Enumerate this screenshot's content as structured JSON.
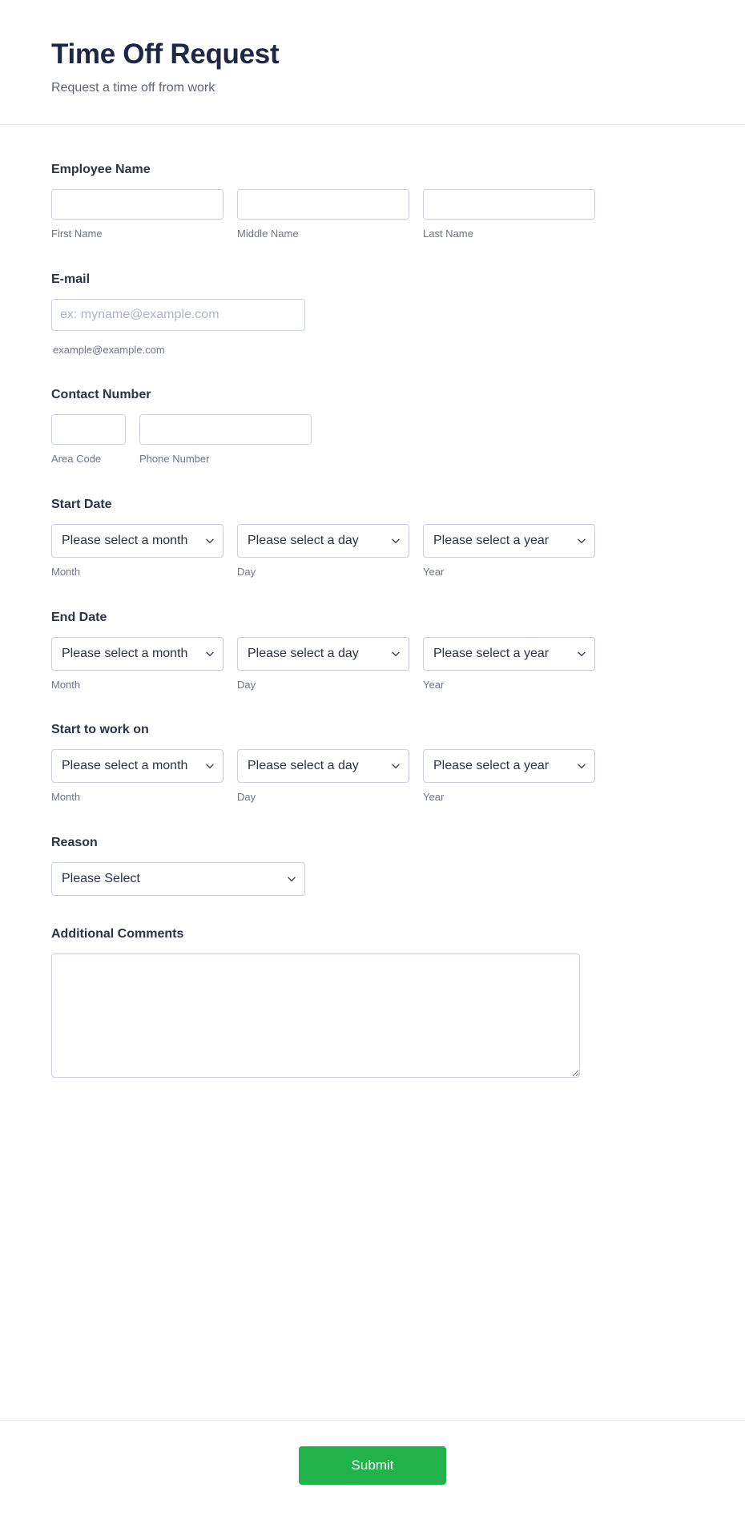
{
  "header": {
    "title": "Time Off Request",
    "subtitle": "Request a time off from work"
  },
  "theme": {
    "submit_button_color": "#22b24c",
    "title_color": "#1f2744",
    "border_color": "#ccd1dd",
    "sub_label_color": "#6f7489"
  },
  "fields": {
    "employee_name": {
      "label": "Employee Name",
      "parts": [
        {
          "value": "",
          "placeholder": "",
          "sub_label": "First Name"
        },
        {
          "value": "",
          "placeholder": "",
          "sub_label": "Middle Name"
        },
        {
          "value": "",
          "placeholder": "",
          "sub_label": "Last Name"
        }
      ]
    },
    "email": {
      "label": "E-mail",
      "value": "",
      "placeholder": "ex: myname@example.com",
      "sub_label": "example@example.com"
    },
    "contact_number": {
      "label": "Contact Number",
      "parts": [
        {
          "value": "",
          "placeholder": "",
          "sub_label": "Area Code"
        },
        {
          "value": "",
          "placeholder": "",
          "sub_label": "Phone Number"
        }
      ]
    },
    "start_date": {
      "label": "Start Date",
      "month": {
        "selected": "Please select a month",
        "sub_label": "Month"
      },
      "day": {
        "selected": "Please select a day",
        "sub_label": "Day"
      },
      "year": {
        "selected": "Please select a year",
        "sub_label": "Year"
      }
    },
    "end_date": {
      "label": "End Date",
      "month": {
        "selected": "Please select a month",
        "sub_label": "Month"
      },
      "day": {
        "selected": "Please select a day",
        "sub_label": "Day"
      },
      "year": {
        "selected": "Please select a year",
        "sub_label": "Year"
      }
    },
    "start_to_work_on": {
      "label": "Start to work on",
      "month": {
        "selected": "Please select a month",
        "sub_label": "Month"
      },
      "day": {
        "selected": "Please select a day",
        "sub_label": "Day"
      },
      "year": {
        "selected": "Please select a year",
        "sub_label": "Year"
      }
    },
    "reason": {
      "label": "Reason",
      "selected": "Please Select"
    },
    "additional_comments": {
      "label": "Additional Comments",
      "value": "",
      "placeholder": ""
    }
  },
  "footer": {
    "submit_label": "Submit"
  },
  "icons": {
    "chevron_down": "chevron-down-icon"
  }
}
